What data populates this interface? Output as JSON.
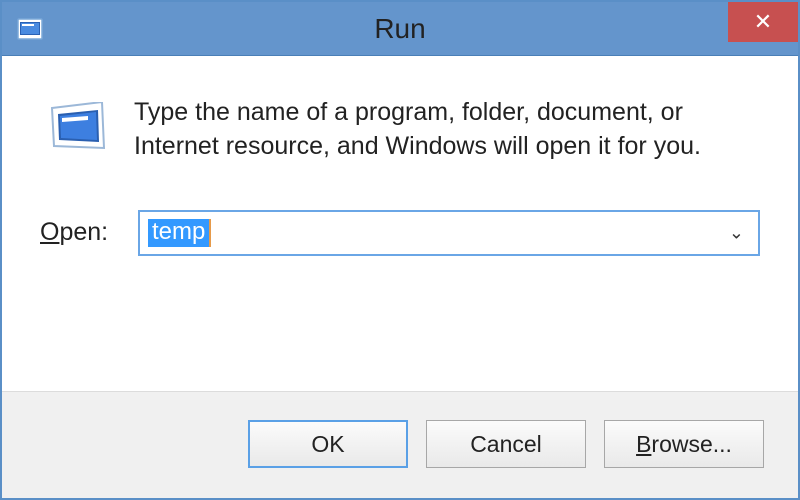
{
  "window": {
    "title": "Run",
    "close_glyph": "✕"
  },
  "body": {
    "description": "Type the name of a program, folder, document, or Internet resource, and Windows will open it for you.",
    "open_label_pre": "O",
    "open_label_post": "pen:",
    "input_value": "temp",
    "dropdown_glyph": "⌄"
  },
  "buttons": {
    "ok": "OK",
    "cancel": "Cancel",
    "browse_pre": "B",
    "browse_post": "rowse..."
  }
}
